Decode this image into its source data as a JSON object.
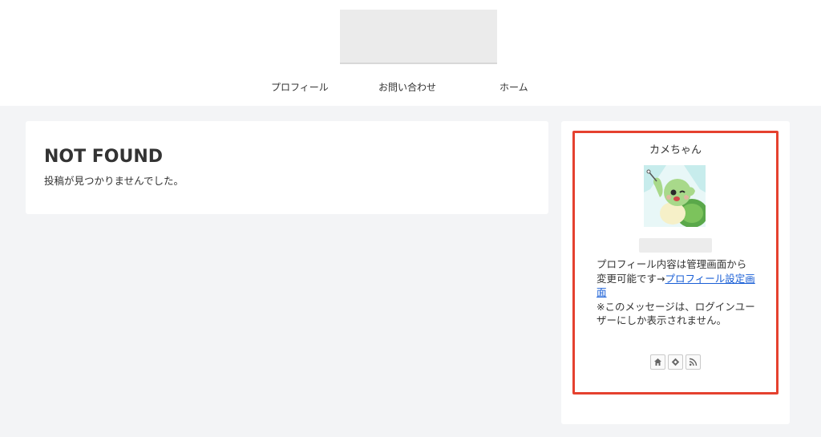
{
  "nav": {
    "items": [
      {
        "label": "プロフィール"
      },
      {
        "label": "お問い合わせ"
      },
      {
        "label": "ホーム"
      }
    ]
  },
  "main": {
    "title": "NOT FOUND",
    "message": "投稿が見つかりませんでした。"
  },
  "profile": {
    "name": "カメちゃん",
    "description_text": "プロフィール内容は管理画面から変更可能です→",
    "link_label": "プロフィール設定画面",
    "note": "※このメッセージは、ログインユーザーにしか表示されません。",
    "social_icons": [
      "home-icon",
      "feedly-icon",
      "rss-icon"
    ],
    "highlight_color": "#e5412f",
    "link_color": "#1a5fd6"
  }
}
